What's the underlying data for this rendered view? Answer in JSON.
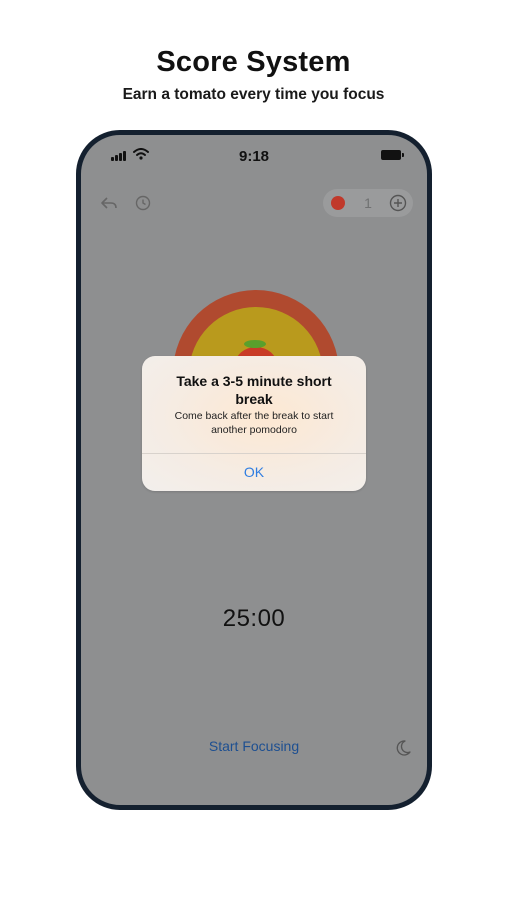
{
  "promo": {
    "title": "Score System",
    "subtitle": "Earn a tomato every time you focus"
  },
  "status_bar": {
    "time": "9:18"
  },
  "toolbar": {
    "tomato_count": "1",
    "icons": [
      "reply-icon",
      "clock-icon",
      "tomato-icon",
      "add-circle-icon"
    ]
  },
  "timer": {
    "display": "25:00",
    "start_label": "Start Focusing"
  },
  "alert": {
    "title": "Take a 3-5 minute short break",
    "message": "Come back after the break to start another pomodoro",
    "ok_label": "OK"
  },
  "colors": {
    "overlay": "#8e8f90",
    "accent_blue": "#2f7de1",
    "ring_outer": "#b04a2f",
    "ring_inner": "#b99a1d",
    "tomato": "#c93b26",
    "phone_frame": "#14202f"
  }
}
